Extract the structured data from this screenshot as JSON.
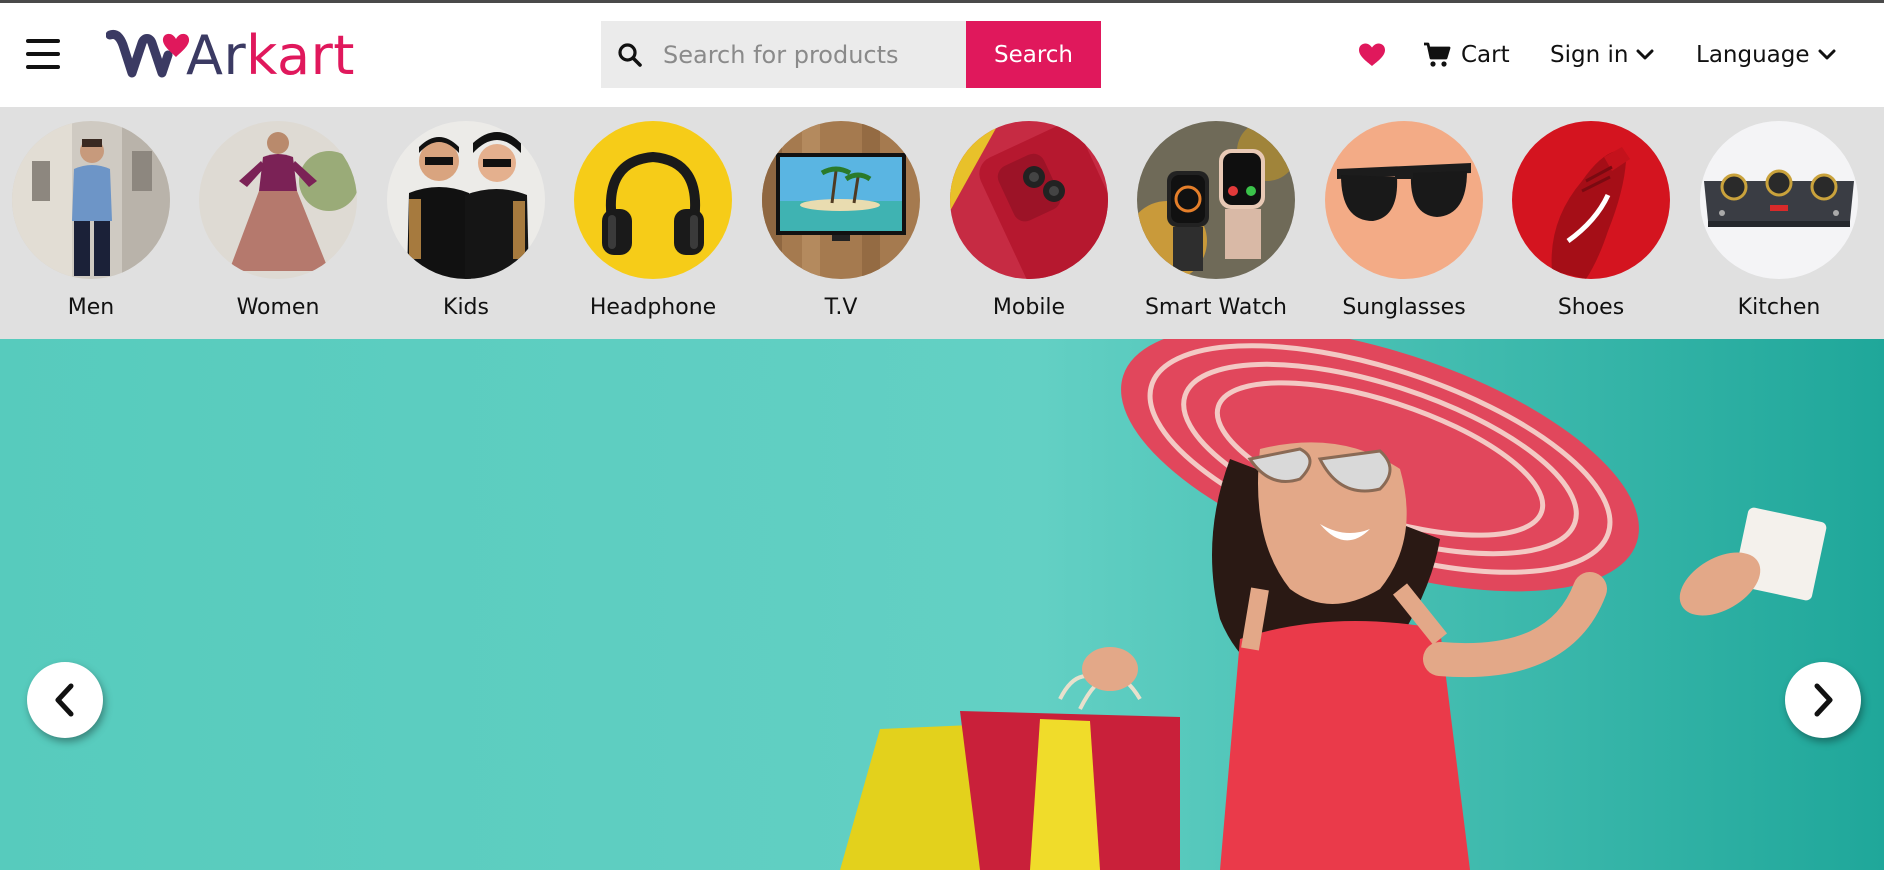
{
  "brand": {
    "logo_part1": "Ar",
    "logo_part2": "kart",
    "accent_color": "#e0185c",
    "dark_color": "#3b3a63"
  },
  "header": {
    "menu_icon": "hamburger-icon",
    "search": {
      "placeholder": "Search for products",
      "value": "",
      "button_label": "Search",
      "icon": "search-icon"
    },
    "wishlist_icon": "heart-icon",
    "cart_label": "Cart",
    "signin_label": "Sign in",
    "language_label": "Language"
  },
  "categories": [
    {
      "label": "Men"
    },
    {
      "label": "Women"
    },
    {
      "label": "Kids"
    },
    {
      "label": "Headphone"
    },
    {
      "label": "T.V"
    },
    {
      "label": "Mobile"
    },
    {
      "label": "Smart Watch"
    },
    {
      "label": "Sunglasses"
    },
    {
      "label": "Shoes"
    },
    {
      "label": "Kitchen"
    }
  ],
  "hero": {
    "background_color": "#57cbbd",
    "prev_icon": "chevron-left-icon",
    "next_icon": "chevron-right-icon"
  }
}
